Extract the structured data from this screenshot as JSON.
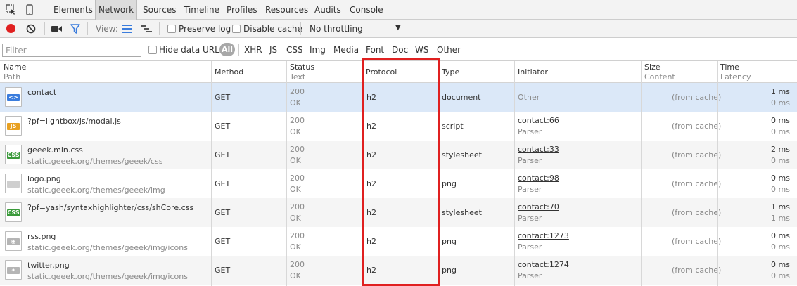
{
  "tabs": {
    "items": [
      "Elements",
      "Network",
      "Sources",
      "Timeline",
      "Profiles",
      "Resources",
      "Audits",
      "Console"
    ],
    "active": "Network"
  },
  "toolbar": {
    "view_label": "View:",
    "preserve_log": "Preserve log",
    "disable_cache": "Disable cache",
    "throttling": "No throttling"
  },
  "filter": {
    "placeholder": "Filter",
    "hide_data_urls": "Hide data URLs",
    "types": [
      "All",
      "XHR",
      "JS",
      "CSS",
      "Img",
      "Media",
      "Font",
      "Doc",
      "WS",
      "Other"
    ]
  },
  "columns": {
    "name": "Name",
    "path": "Path",
    "method": "Method",
    "status": "Status",
    "text": "Text",
    "protocol": "Protocol",
    "type": "Type",
    "initiator": "Initiator",
    "size": "Size",
    "content": "Content",
    "time": "Time",
    "latency": "Latency"
  },
  "rows": [
    {
      "name": "contact",
      "path": "",
      "icon": "html-file-icon",
      "method": "GET",
      "status": "200",
      "text": "OK",
      "protocol": "h2",
      "type": "document",
      "initiator": "Other",
      "initiator_sub": "",
      "size": "(from cache)",
      "time": "1 ms",
      "latency": "0 ms"
    },
    {
      "name": "?pf=lightbox/js/modal.js",
      "path": "",
      "icon": "js-file-icon",
      "method": "GET",
      "status": "200",
      "text": "OK",
      "protocol": "h2",
      "type": "script",
      "initiator": "contact:66",
      "initiator_sub": "Parser",
      "size": "(from cache)",
      "time": "0 ms",
      "latency": "0 ms"
    },
    {
      "name": "geeek.min.css",
      "path": "static.geeek.org/themes/geeek/css",
      "icon": "css-file-icon",
      "method": "GET",
      "status": "200",
      "text": "OK",
      "protocol": "h2",
      "type": "stylesheet",
      "initiator": "contact:33",
      "initiator_sub": "Parser",
      "size": "(from cache)",
      "time": "2 ms",
      "latency": "0 ms"
    },
    {
      "name": "logo.png",
      "path": "static.geeek.org/themes/geeek/img",
      "icon": "image-file-icon",
      "method": "GET",
      "status": "200",
      "text": "OK",
      "protocol": "h2",
      "type": "png",
      "initiator": "contact:98",
      "initiator_sub": "Parser",
      "size": "(from cache)",
      "time": "0 ms",
      "latency": "0 ms"
    },
    {
      "name": "?pf=yash/syntaxhighlighter/css/shCore.css",
      "path": "",
      "icon": "css-file-icon",
      "method": "GET",
      "status": "200",
      "text": "OK",
      "protocol": "h2",
      "type": "stylesheet",
      "initiator": "contact:70",
      "initiator_sub": "Parser",
      "size": "(from cache)",
      "time": "1 ms",
      "latency": "1 ms"
    },
    {
      "name": "rss.png",
      "path": "static.geeek.org/themes/geeek/img/icons",
      "icon": "rss-image-icon",
      "method": "GET",
      "status": "200",
      "text": "OK",
      "protocol": "h2",
      "type": "png",
      "initiator": "contact:1273",
      "initiator_sub": "Parser",
      "size": "(from cache)",
      "time": "0 ms",
      "latency": "0 ms"
    },
    {
      "name": "twitter.png",
      "path": "static.geeek.org/themes/geeek/img/icons",
      "icon": "twitter-image-icon",
      "method": "GET",
      "status": "200",
      "text": "OK",
      "protocol": "h2",
      "type": "png",
      "initiator": "contact:1274",
      "initiator_sub": "Parser",
      "size": "(from cache)",
      "time": "0 ms",
      "latency": "0 ms"
    }
  ],
  "colors": {
    "record": "#e02020",
    "filter_active": "#3b7ddd",
    "highlight_box": "#e02020",
    "selected_row": "#dbe8f8"
  }
}
